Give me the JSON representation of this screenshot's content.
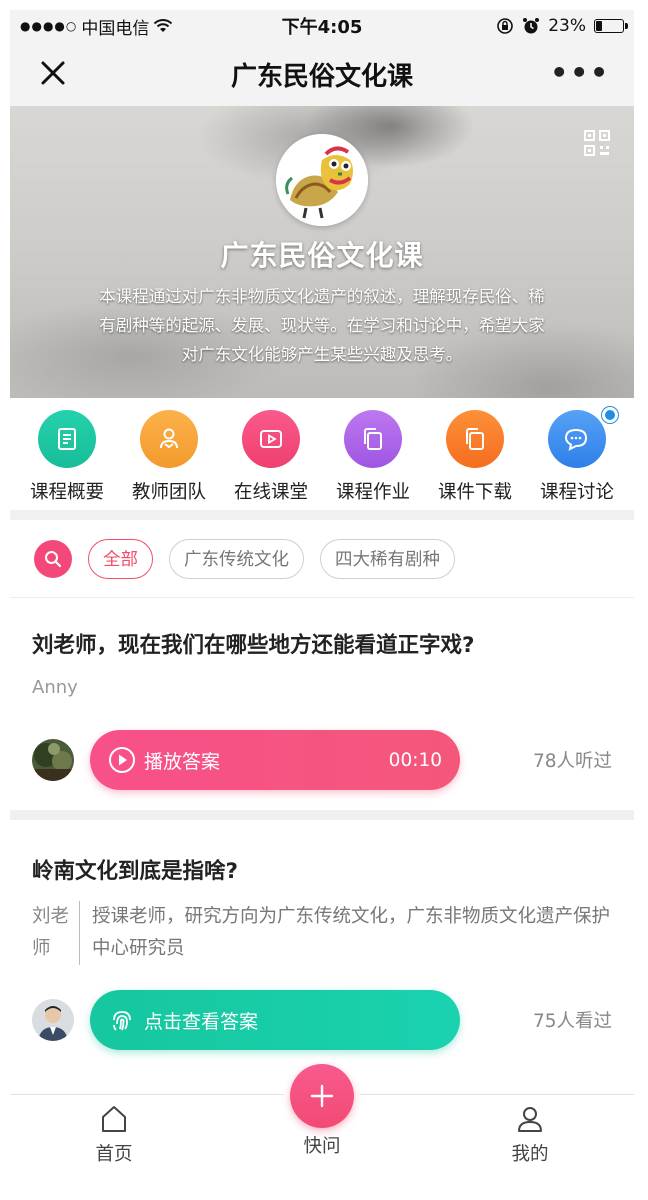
{
  "status_bar": {
    "signal": "●●●●○",
    "carrier": "中国电信",
    "time": "下午4:05",
    "battery": "23%",
    "battery_level": 0.23
  },
  "nav": {
    "title": "广东民俗文化课",
    "more": "•••"
  },
  "hero": {
    "title": "广东民俗文化课",
    "description": "本课程通过对广东非物质文化遗产的叙述，理解现存民俗、稀有剧种等的起源、发展、现状等。在学习和讨论中，希望大家对广东文化能够产生某些兴趣及思考。"
  },
  "menu": [
    {
      "label": "课程概要",
      "icon": "document-icon",
      "color": "#1fc7a3"
    },
    {
      "label": "教师团队",
      "icon": "teacher-icon",
      "color": "#f7a23a"
    },
    {
      "label": "在线课堂",
      "icon": "video-icon",
      "color": "#f4467a"
    },
    {
      "label": "课程作业",
      "icon": "copy-icon",
      "color": "#b065e8"
    },
    {
      "label": "课件下载",
      "icon": "download-file-icon",
      "color": "#f97f2c"
    },
    {
      "label": "课程讨论",
      "icon": "chat-icon",
      "color": "#3f8ff0"
    }
  ],
  "filters": {
    "chips": [
      "全部",
      "广东传统文化",
      "四大稀有剧种"
    ],
    "active_index": 0
  },
  "questions": [
    {
      "title": "刘老师，现在我们在哪些地方还能看道正字戏?",
      "author": "Anny",
      "action_label": "播放答案",
      "duration": "00:10",
      "count": "78人听过"
    },
    {
      "title": "岭南文化到底是指啥?",
      "teacher_name": "刘老师",
      "teacher_desc": "授课老师，研究方向为广东传统文化，广东非物质文化遗产保护中心研究员",
      "action_label": "点击查看答案",
      "count": "75人看过"
    }
  ],
  "tabbar": {
    "home": "首页",
    "ask": "快问",
    "mine": "我的"
  },
  "colors": {
    "accent_pink": "#f5487a",
    "accent_green": "#16c79f"
  }
}
